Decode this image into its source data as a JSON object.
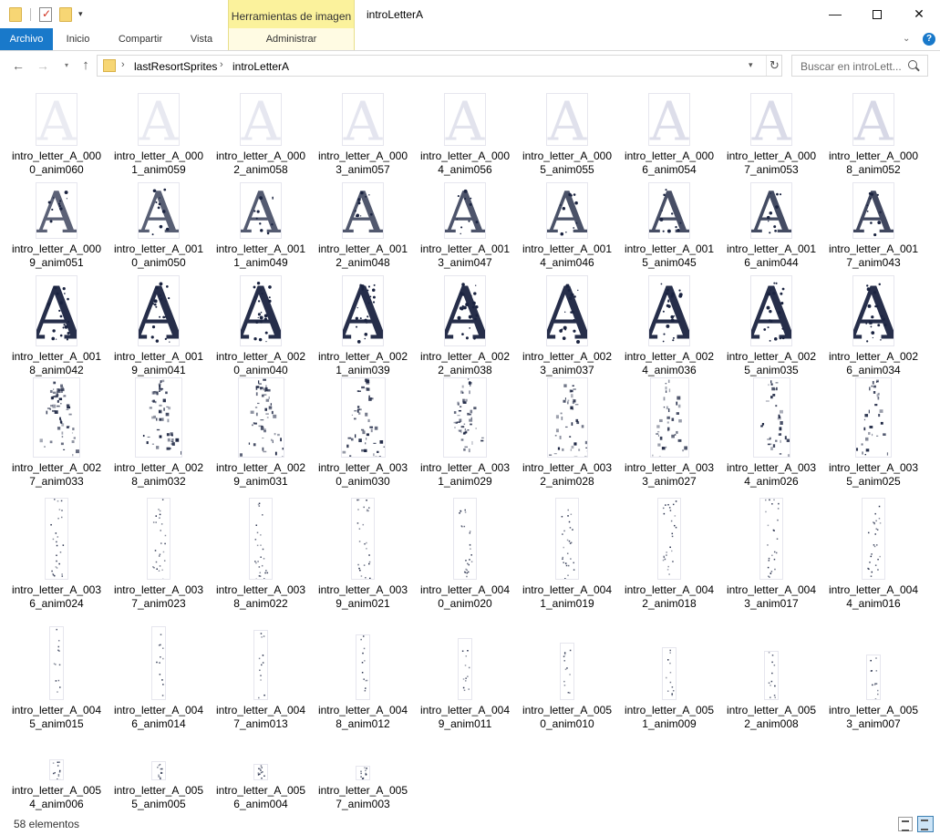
{
  "titlebar": {
    "contextual_tab_group": "Herramientas de imagen",
    "window_title": "introLetterA",
    "minimize_glyph": "—",
    "close_glyph": "✕",
    "quick_access_dropdown": "▾"
  },
  "ribbon": {
    "tabs": [
      "Archivo",
      "Inicio",
      "Compartir",
      "Vista",
      "Administrar"
    ],
    "collapse_glyph": "⌄",
    "help_glyph": "?"
  },
  "address": {
    "back_glyph": "←",
    "forward_glyph": "→",
    "recent_glyph": "▾",
    "up_glyph": "↑",
    "crumbs": [
      "lastResortSprites",
      "introLetterA"
    ],
    "crumb_separator": "›",
    "dropdown_glyph": "▾",
    "refresh_glyph": "↻",
    "search_placeholder": "Buscar en introLett..."
  },
  "files": [
    {
      "label": "intro_letter_A_000\n0_anim060",
      "thumb": {
        "type": "ghost",
        "level": 0.08
      }
    },
    {
      "label": "intro_letter_A_000\n1_anim059",
      "thumb": {
        "type": "ghost",
        "level": 0.12
      }
    },
    {
      "label": "intro_letter_A_000\n2_anim058",
      "thumb": {
        "type": "ghost",
        "level": 0.16
      }
    },
    {
      "label": "intro_letter_A_000\n3_anim057",
      "thumb": {
        "type": "ghost",
        "level": 0.2
      }
    },
    {
      "label": "intro_letter_A_000\n4_anim056",
      "thumb": {
        "type": "ghost",
        "level": 0.25
      }
    },
    {
      "label": "intro_letter_A_000\n5_anim055",
      "thumb": {
        "type": "ghost",
        "level": 0.3
      }
    },
    {
      "label": "intro_letter_A_000\n6_anim054",
      "thumb": {
        "type": "ghost",
        "level": 0.35
      }
    },
    {
      "label": "intro_letter_A_000\n7_anim053",
      "thumb": {
        "type": "ghost",
        "level": 0.42
      }
    },
    {
      "label": "intro_letter_A_000\n8_anim052",
      "thumb": {
        "type": "ghost",
        "level": 0.5
      }
    },
    {
      "label": "intro_letter_A_000\n9_anim051",
      "thumb": {
        "type": "solid",
        "level": 0.55
      }
    },
    {
      "label": "intro_letter_A_001\n0_anim050",
      "thumb": {
        "type": "solid",
        "level": 0.6
      }
    },
    {
      "label": "intro_letter_A_001\n1_anim049",
      "thumb": {
        "type": "solid",
        "level": 0.65
      }
    },
    {
      "label": "intro_letter_A_001\n2_anim048",
      "thumb": {
        "type": "solid",
        "level": 0.7
      }
    },
    {
      "label": "intro_letter_A_001\n3_anim047",
      "thumb": {
        "type": "solid",
        "level": 0.75
      }
    },
    {
      "label": "intro_letter_A_001\n4_anim046",
      "thumb": {
        "type": "solid",
        "level": 0.8
      }
    },
    {
      "label": "intro_letter_A_001\n5_anim045",
      "thumb": {
        "type": "solid",
        "level": 0.85
      }
    },
    {
      "label": "intro_letter_A_001\n6_anim044",
      "thumb": {
        "type": "solid",
        "level": 0.9
      }
    },
    {
      "label": "intro_letter_A_001\n7_anim043",
      "thumb": {
        "type": "solid",
        "level": 0.95
      }
    },
    {
      "label": "intro_letter_A_001\n8_anim042",
      "thumb": {
        "type": "dark",
        "level": 1
      }
    },
    {
      "label": "intro_letter_A_001\n9_anim041",
      "thumb": {
        "type": "dark",
        "level": 1
      }
    },
    {
      "label": "intro_letter_A_002\n0_anim040",
      "thumb": {
        "type": "dark",
        "level": 1
      }
    },
    {
      "label": "intro_letter_A_002\n1_anim039",
      "thumb": {
        "type": "dark",
        "level": 1
      }
    },
    {
      "label": "intro_letter_A_002\n2_anim038",
      "thumb": {
        "type": "dark",
        "level": 1
      }
    },
    {
      "label": "intro_letter_A_002\n3_anim037",
      "thumb": {
        "type": "dark",
        "level": 1
      }
    },
    {
      "label": "intro_letter_A_002\n4_anim036",
      "thumb": {
        "type": "dark",
        "level": 1
      }
    },
    {
      "label": "intro_letter_A_002\n5_anim035",
      "thumb": {
        "type": "dark",
        "level": 1
      }
    },
    {
      "label": "intro_letter_A_002\n6_anim034",
      "thumb": {
        "type": "dark",
        "level": 1
      }
    },
    {
      "label": "intro_letter_A_002\n7_anim033",
      "thumb": {
        "type": "shatter",
        "level": 1
      }
    },
    {
      "label": "intro_letter_A_002\n8_anim032",
      "thumb": {
        "type": "shatter",
        "level": 1
      }
    },
    {
      "label": "intro_letter_A_002\n9_anim031",
      "thumb": {
        "type": "shatter",
        "level": 0.95
      }
    },
    {
      "label": "intro_letter_A_003\n0_anim030",
      "thumb": {
        "type": "shatter",
        "level": 0.85
      }
    },
    {
      "label": "intro_letter_A_003\n1_anim029",
      "thumb": {
        "type": "shatter",
        "level": 0.8
      }
    },
    {
      "label": "intro_letter_A_003\n2_anim028",
      "thumb": {
        "type": "shatter",
        "level": 0.65
      }
    },
    {
      "label": "intro_letter_A_003\n3_anim027",
      "thumb": {
        "type": "shatter",
        "level": 0.55
      }
    },
    {
      "label": "intro_letter_A_003\n4_anim026",
      "thumb": {
        "type": "shatter",
        "level": 0.45
      }
    },
    {
      "label": "intro_letter_A_003\n5_anim025",
      "thumb": {
        "type": "shatter",
        "level": 0.4
      }
    },
    {
      "label": "intro_letter_A_003\n6_anim024",
      "thumb": {
        "type": "specks",
        "level": 0.45
      }
    },
    {
      "label": "intro_letter_A_003\n7_anim023",
      "thumb": {
        "type": "specks",
        "level": 0.45
      }
    },
    {
      "label": "intro_letter_A_003\n8_anim022",
      "thumb": {
        "type": "specks",
        "level": 0.45
      }
    },
    {
      "label": "intro_letter_A_003\n9_anim021",
      "thumb": {
        "type": "specks",
        "level": 0.5
      }
    },
    {
      "label": "intro_letter_A_004\n0_anim020",
      "thumb": {
        "type": "specks",
        "level": 0.55
      }
    },
    {
      "label": "intro_letter_A_004\n1_anim019",
      "thumb": {
        "type": "specks",
        "level": 0.55
      }
    },
    {
      "label": "intro_letter_A_004\n2_anim018",
      "thumb": {
        "type": "specks",
        "level": 0.55
      }
    },
    {
      "label": "intro_letter_A_004\n3_anim017",
      "thumb": {
        "type": "specks",
        "level": 0.55
      }
    },
    {
      "label": "intro_letter_A_004\n4_anim016",
      "thumb": {
        "type": "specks",
        "level": 0.55
      }
    },
    {
      "label": "intro_letter_A_004\n5_anim015",
      "thumb": {
        "type": "strip",
        "level": 0.6
      }
    },
    {
      "label": "intro_letter_A_004\n6_anim014",
      "thumb": {
        "type": "strip",
        "level": 0.6
      }
    },
    {
      "label": "intro_letter_A_004\n7_anim013",
      "thumb": {
        "type": "strip",
        "level": 0.55
      }
    },
    {
      "label": "intro_letter_A_004\n8_anim012",
      "thumb": {
        "type": "strip",
        "level": 0.5
      }
    },
    {
      "label": "intro_letter_A_004\n9_anim011",
      "thumb": {
        "type": "strip",
        "level": 0.45
      }
    },
    {
      "label": "intro_letter_A_005\n0_anim010",
      "thumb": {
        "type": "strip",
        "level": 0.4
      }
    },
    {
      "label": "intro_letter_A_005\n1_anim009",
      "thumb": {
        "type": "strip",
        "level": 0.35
      }
    },
    {
      "label": "intro_letter_A_005\n2_anim008",
      "thumb": {
        "type": "strip",
        "level": 0.3
      }
    },
    {
      "label": "intro_letter_A_005\n3_anim007",
      "thumb": {
        "type": "strip",
        "level": 0.25
      }
    },
    {
      "label": "intro_letter_A_005\n4_anim006",
      "thumb": {
        "type": "strip",
        "level": 0.2
      }
    },
    {
      "label": "intro_letter_A_005\n5_anim005",
      "thumb": {
        "type": "strip",
        "level": 0.15
      }
    },
    {
      "label": "intro_letter_A_005\n6_anim004",
      "thumb": {
        "type": "strip",
        "level": 0.1
      }
    },
    {
      "label": "intro_letter_A_005\n7_anim003",
      "thumb": {
        "type": "strip",
        "level": 0.05
      }
    }
  ],
  "status": {
    "item_count": "58 elementos"
  },
  "colors": {
    "accent": "#1979ca",
    "context_tab": "#fbf29c",
    "ink": "#1a2340"
  }
}
